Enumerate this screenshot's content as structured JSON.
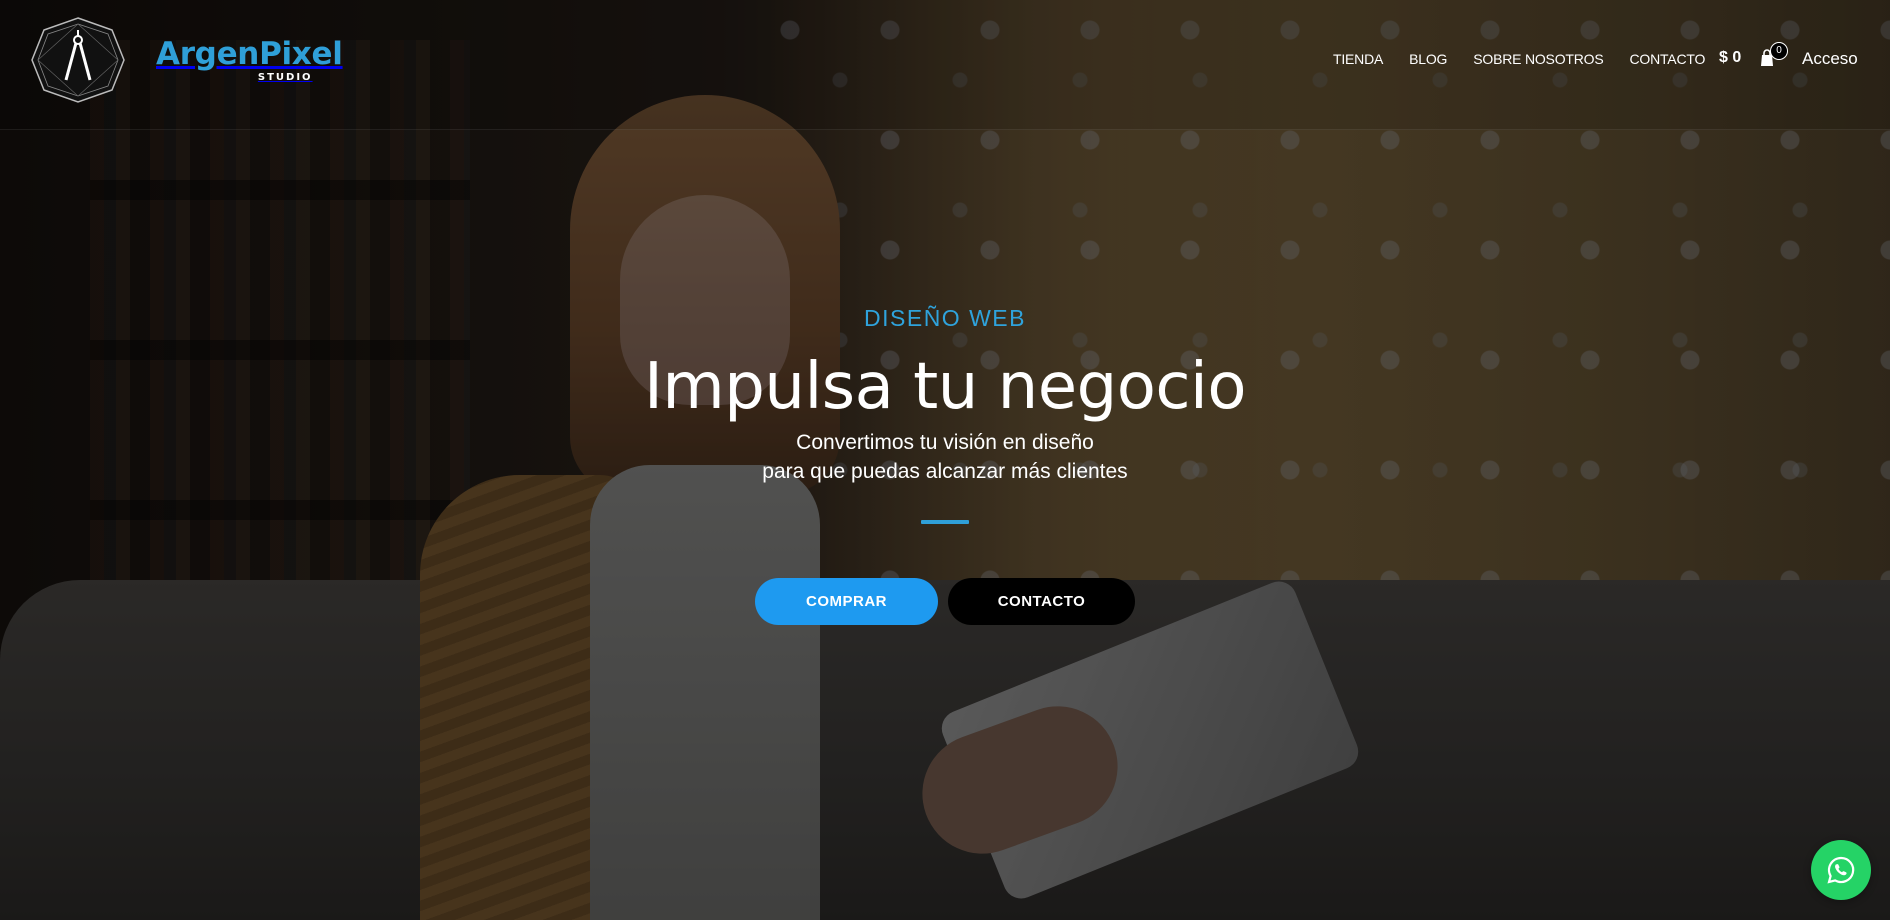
{
  "brand": {
    "name": "ArgenPixel",
    "sub": "STUDIO",
    "accent": "#2f9fd8"
  },
  "nav": {
    "items": [
      {
        "label": "TIENDA"
      },
      {
        "label": "BLOG"
      },
      {
        "label": "SOBRE NOSOTROS"
      },
      {
        "label": "CONTACTO"
      }
    ]
  },
  "cart": {
    "total": "$ 0",
    "count": "0",
    "icon": "shopping-bag-icon"
  },
  "account": {
    "login_label": "Acceso"
  },
  "hero": {
    "eyebrow": "DISEÑO WEB",
    "title": "Impulsa tu negocio",
    "subtitle_line1": "Convertimos tu visión en diseño",
    "subtitle_line2": "para que puedas alcanzar más clientes",
    "primary_cta": "COMPRAR",
    "secondary_cta": "CONTACTO",
    "primary_color": "#1e9af0",
    "secondary_color": "#000000"
  },
  "floating": {
    "whatsapp_icon": "whatsapp-icon",
    "color": "#25d366"
  }
}
